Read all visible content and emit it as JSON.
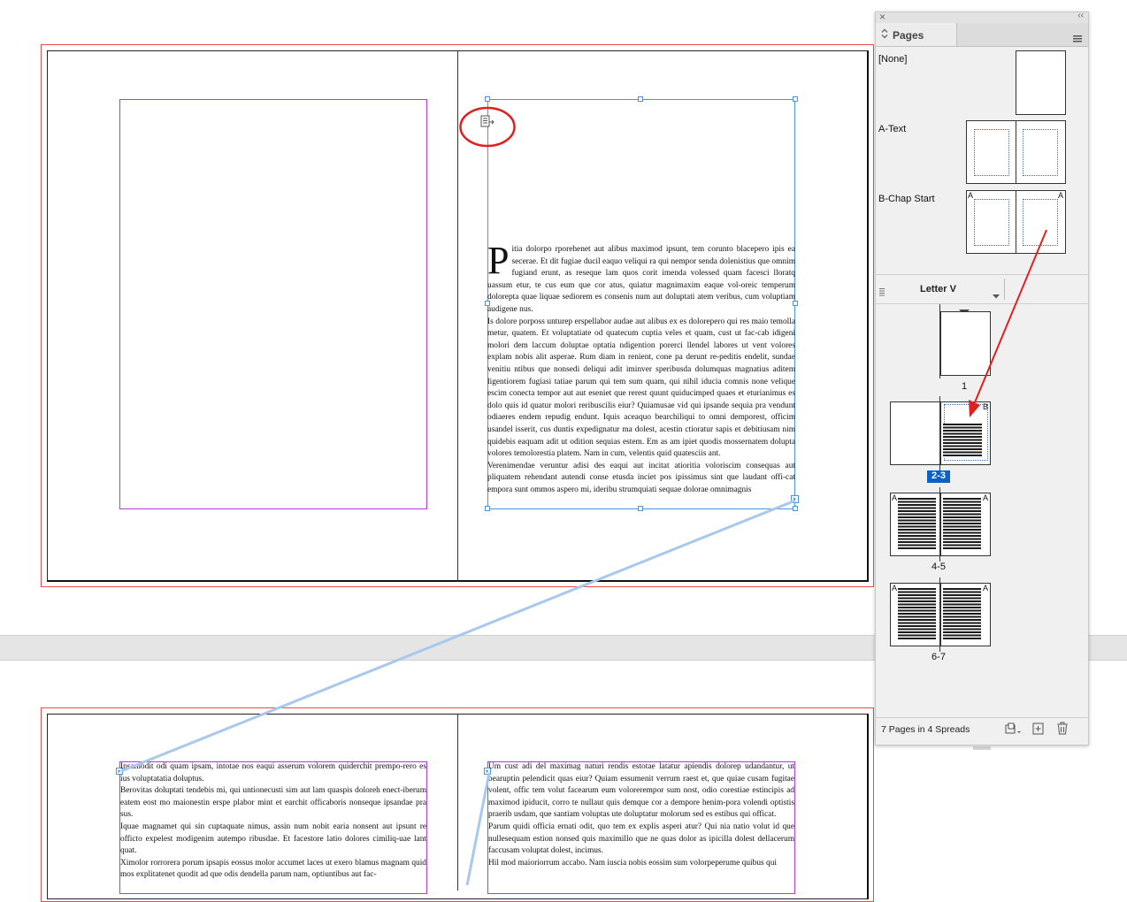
{
  "colors": {
    "bleed": "#ef4a4a",
    "margin": "#b23ad6",
    "frame_selection": "#4d93d9",
    "thread": "#a9c8ee",
    "annotation": "#e02020",
    "panel_bg": "#f0f0f0",
    "selected_label": "#0b62c4"
  },
  "document": {
    "top_spread": {
      "right_page_text": {
        "dropcap": "P",
        "paragraphs": [
          "itia dolorpo rporehenet aut alibus maximod ipsunt, tem corunto blacepero ipis ea secerae. Et dit fugiae ducil eaquo veliqui ra qui nempor senda dolenistius que omnim fugiand erunt, as reseque lam quos corit imenda volessed quam facesci lloratq uassum etur, te cus eum que cor atus, quiatur magnimaxim eaque vol-oreic temperum dolorepta quae liquae sediorem es consenis num aut doluptati atem veribus, cum voluptiam audigene nus.",
          "Is dolore porposs unturep erspellabor audae aut alibus ex es dolorepero qui res maio temolla metur, quatem. Et voluptatiate od quatecum cuptia veles et quam, cust ut fac-cab idigeni molori dem laccum doluptae optatia ndigention porerci llendel labores ut vent volores explam nobis alit asperae. Rum diam in renient, cone pa derunt re-peditis endelit, sundae venitiu ntibus que nonsedi deliqui adit iminver speribusda dolumquas magnatius aditem ligentiorem fugiasi tatiae parum qui tem sum quam, qui nihil iducia comnis none velique escim conecta tempor aut aut eseniet que rerest quunt quiducimped quaes et eturianimus es dolo quis id quatur molori reribuscilis eiur? Quiamusae vid qui ipsande sequia pra vendunt odiaeres endem repudig endunt. Iquis aceaquo bearchiliqui to omni demporest, officim usandel isserit, cus duntis expedignatur ma dolest, acestin ctioratur sapis et debitiusam nim quidebis eaquam adit ut odition sequias estem. Em as am ipiet quodis mossernatem dolupta volores temolorestia platem. Nam in cum, velentis quid quatesciis ant.",
          "Verenimendae veruntur adisi des eaqui aut incitat atioritia voloriscim consequas aut pliquatem rehendant autendi conse etusda inciet pos ipissimus sint que laudant offi-cat empora sunt ommos aspero mi, ideribu strumquiati sequae dolorae omnimagnis"
        ]
      }
    },
    "bottom_spread": {
      "left_page_text": [
        "Ipsamodit odi quam ipsam, intotae nos eaqui asserum volorem quiderchit prempo-rero es ius voluptatatia doluptus.",
        "Berovitas doluptati tendebis mi, qui untionecusti sim aut lam quaspis doloreh enect-iberum eatem eost mo maionestin erspe plabor mint et earchit officaboris nonseque ipsandae pra sus.",
        "Iquae magnamet qui sin cuptaquate nimus, assin num nobit earia nonsent aut ipsunt re officto expelest modigenim autempo ribusdae. Et facestore latio dolores cimiliq-uae lant quat.",
        "Ximolor rorrorera porum ipsapis eossus molor accumet laces ut exero blamus magnam quid mos explitatenet quodit ad que odis dendella parum nam, optiuntibus aut fac-"
      ],
      "right_page_text": [
        "Um cust adi del maximag naturi rendis estotae latatur apiendis dolorep udandantur, ut bearuptin pelendicit quas eiur? Quiam essumenit verrum raest et, que quiae cusam fugitae volent, offic tem volut facearum eum volorerempor sum nost, odio corestiae estincipis ad maximod ipiducit, corro te nullaut quis demque cor a dempore henim-pora volendi optistis praerib usdam, que santiam voluptas ute doluptatur molorum sed es estibus qui officat.",
        "Parum quidi officia ernati odit, quo tem ex explis asperi atur? Qui nia natio volut id que nullesequam estion nonsed quis maximillo que ne quas dolor as ipicilla dolest dellacerum faccusam voluptat dolest, incimus.",
        "Hil mod maioriorrum accabo. Nam iuscia nobis eossim sum volorpeperume quibus qui"
      ]
    }
  },
  "pages_panel": {
    "close_glyph": "×",
    "collapse_glyph": "‹‹",
    "tab_label": "Pages",
    "tab_arrows_glyph": "⌃⌄",
    "menu_icon": "hamburger-menu-icon",
    "masters": [
      {
        "name": "[None]"
      },
      {
        "name": "A-Text"
      },
      {
        "name": "B-Chap Start",
        "prefix_left": "A",
        "prefix_right": "A"
      }
    ],
    "page_size": "Letter V",
    "spreads": [
      {
        "label": "1"
      },
      {
        "label": "2-3",
        "selected": true,
        "right_prefix": "B"
      },
      {
        "label": "4-5",
        "left_prefix": "A",
        "right_prefix": "A"
      },
      {
        "label": "6-7",
        "left_prefix": "A",
        "right_prefix": "A"
      }
    ],
    "footer_status": "7 Pages in 4 Spreads"
  }
}
